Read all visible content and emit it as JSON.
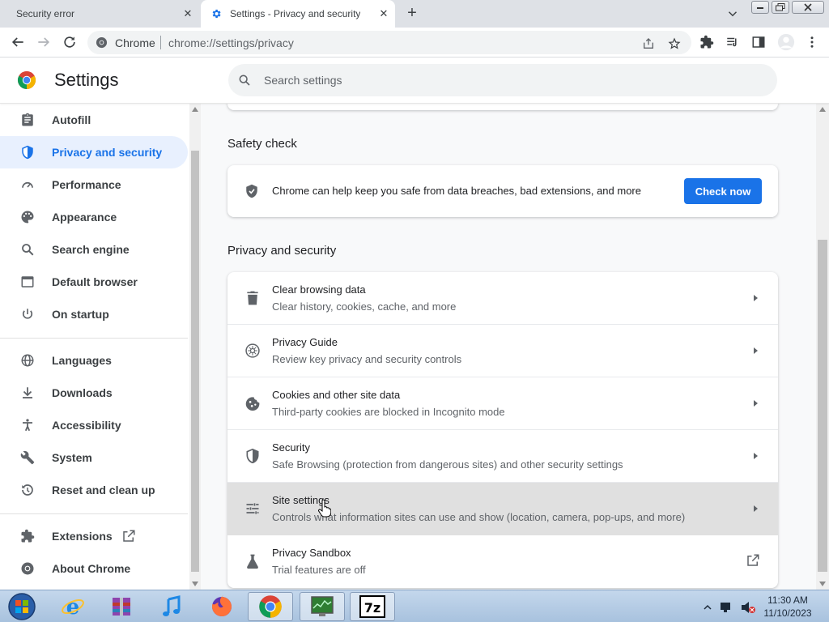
{
  "browser": {
    "tabs": [
      {
        "title": "Security error",
        "active": false
      },
      {
        "title": "Settings - Privacy and security",
        "active": true
      }
    ],
    "omnibox": {
      "scheme_label": "Chrome",
      "url": "chrome://settings/privacy"
    }
  },
  "settings": {
    "title": "Settings",
    "search_placeholder": "Search settings",
    "sidebar": [
      {
        "label": "Autofill",
        "icon": "clipboard-icon"
      },
      {
        "label": "Privacy and security",
        "icon": "shield-icon",
        "active": true
      },
      {
        "label": "Performance",
        "icon": "speedometer-icon"
      },
      {
        "label": "Appearance",
        "icon": "palette-icon"
      },
      {
        "label": "Search engine",
        "icon": "search-icon"
      },
      {
        "label": "Default browser",
        "icon": "browser-window-icon"
      },
      {
        "label": "On startup",
        "icon": "power-icon"
      },
      {
        "label": "Languages",
        "icon": "globe-icon"
      },
      {
        "label": "Downloads",
        "icon": "download-icon"
      },
      {
        "label": "Accessibility",
        "icon": "accessibility-icon"
      },
      {
        "label": "System",
        "icon": "wrench-icon"
      },
      {
        "label": "Reset and clean up",
        "icon": "history-icon"
      },
      {
        "label": "Extensions",
        "icon": "puzzle-icon"
      },
      {
        "label": "About Chrome",
        "icon": "chrome-icon"
      }
    ],
    "safety_check": {
      "heading": "Safety check",
      "text": "Chrome can help keep you safe from data breaches, bad extensions, and more",
      "button": "Check now"
    },
    "privacy": {
      "heading": "Privacy and security",
      "rows": [
        {
          "title": "Clear browsing data",
          "subtitle": "Clear history, cookies, cache, and more",
          "icon": "trash-icon"
        },
        {
          "title": "Privacy Guide",
          "subtitle": "Review key privacy and security controls",
          "icon": "compass-icon"
        },
        {
          "title": "Cookies and other site data",
          "subtitle": "Third-party cookies are blocked in Incognito mode",
          "icon": "cookie-icon"
        },
        {
          "title": "Security",
          "subtitle": "Safe Browsing (protection from dangerous sites) and other security settings",
          "icon": "shield-icon"
        },
        {
          "title": "Site settings",
          "subtitle": "Controls what information sites can use and show (location, camera, pop-ups, and more)",
          "icon": "sliders-icon"
        },
        {
          "title": "Privacy Sandbox",
          "subtitle": "Trial features are off",
          "icon": "flask-icon"
        }
      ]
    }
  },
  "taskbar": {
    "time": "11:30 AM",
    "date": "11/10/2023"
  },
  "colors": {
    "accent": "#1a73e8",
    "active_nav_bg": "#e8f0fe",
    "hover_row_bg": "#e0e0e0"
  }
}
